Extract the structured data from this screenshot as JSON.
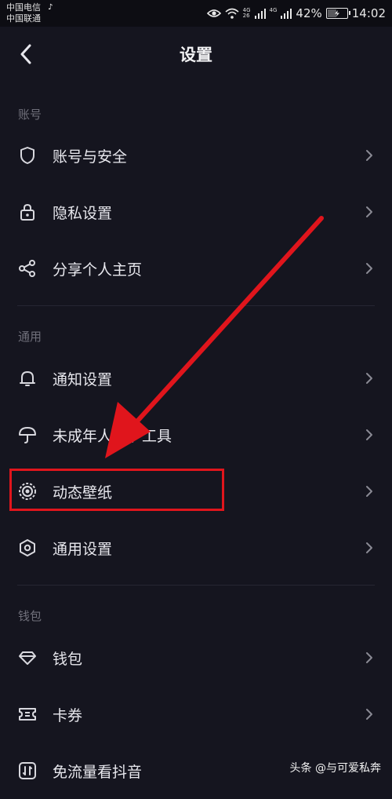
{
  "status_bar": {
    "carrier_1": "中国电信",
    "carrier_2": "中国联通",
    "signal_1_label": "4G",
    "signal_1_sub": "26",
    "signal_2_label": "4G",
    "battery": "42%",
    "battery_level": 0.42,
    "time": "14:02"
  },
  "header": {
    "title": "设置"
  },
  "sections": [
    {
      "heading": "账号",
      "items": [
        {
          "label": "账号与安全",
          "icon": "shield-icon"
        },
        {
          "label": "隐私设置",
          "icon": "lock-icon"
        },
        {
          "label": "分享个人主页",
          "icon": "share-icon"
        }
      ]
    },
    {
      "heading": "通用",
      "items": [
        {
          "label": "通知设置",
          "icon": "bell-icon"
        },
        {
          "label": "未成年人保护工具",
          "icon": "umbrella-icon"
        },
        {
          "label": "动态壁纸",
          "icon": "target-icon"
        },
        {
          "label": "通用设置",
          "icon": "hexagon-icon"
        }
      ]
    },
    {
      "heading": "钱包",
      "items": [
        {
          "label": "钱包",
          "icon": "diamond-icon"
        },
        {
          "label": "卡券",
          "icon": "ticket-icon"
        },
        {
          "label": "免流量看抖音",
          "icon": "data-icon"
        }
      ]
    }
  ],
  "watermark": "头条 @与可爱私奔",
  "colors": {
    "background": "#15151f",
    "annotation": "#e0151c"
  }
}
